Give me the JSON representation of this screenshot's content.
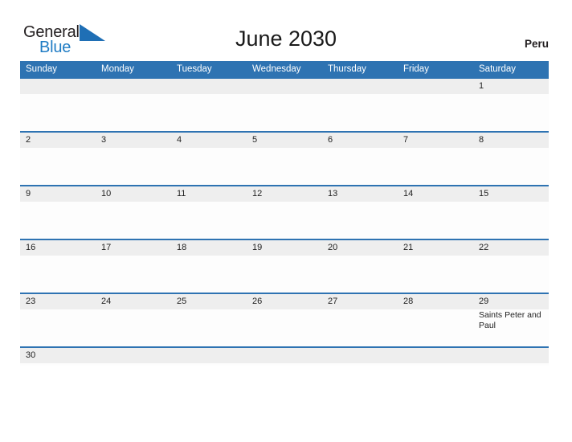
{
  "brand": {
    "name_part1": "General",
    "name_part2": "Blue",
    "flag_icon": "blue-triangle-flag-icon",
    "accent_color": "#1f7cc4"
  },
  "header": {
    "title": "June 2030",
    "country": "Peru"
  },
  "theme": {
    "header_blue": "#2e73b2",
    "band_gray": "#eeeeee",
    "text_dark": "#222222"
  },
  "calendar": {
    "month": "June",
    "year": "2030",
    "day_headers": [
      "Sunday",
      "Monday",
      "Tuesday",
      "Wednesday",
      "Thursday",
      "Friday",
      "Saturday"
    ],
    "weeks": [
      {
        "days": [
          {
            "num": "",
            "event": ""
          },
          {
            "num": "",
            "event": ""
          },
          {
            "num": "",
            "event": ""
          },
          {
            "num": "",
            "event": ""
          },
          {
            "num": "",
            "event": ""
          },
          {
            "num": "",
            "event": ""
          },
          {
            "num": "1",
            "event": ""
          }
        ]
      },
      {
        "days": [
          {
            "num": "2",
            "event": ""
          },
          {
            "num": "3",
            "event": ""
          },
          {
            "num": "4",
            "event": ""
          },
          {
            "num": "5",
            "event": ""
          },
          {
            "num": "6",
            "event": ""
          },
          {
            "num": "7",
            "event": ""
          },
          {
            "num": "8",
            "event": ""
          }
        ]
      },
      {
        "days": [
          {
            "num": "9",
            "event": ""
          },
          {
            "num": "10",
            "event": ""
          },
          {
            "num": "11",
            "event": ""
          },
          {
            "num": "12",
            "event": ""
          },
          {
            "num": "13",
            "event": ""
          },
          {
            "num": "14",
            "event": ""
          },
          {
            "num": "15",
            "event": ""
          }
        ]
      },
      {
        "days": [
          {
            "num": "16",
            "event": ""
          },
          {
            "num": "17",
            "event": ""
          },
          {
            "num": "18",
            "event": ""
          },
          {
            "num": "19",
            "event": ""
          },
          {
            "num": "20",
            "event": ""
          },
          {
            "num": "21",
            "event": ""
          },
          {
            "num": "22",
            "event": ""
          }
        ]
      },
      {
        "days": [
          {
            "num": "23",
            "event": ""
          },
          {
            "num": "24",
            "event": ""
          },
          {
            "num": "25",
            "event": ""
          },
          {
            "num": "26",
            "event": ""
          },
          {
            "num": "27",
            "event": ""
          },
          {
            "num": "28",
            "event": ""
          },
          {
            "num": "29",
            "event": "Saints Peter and Paul"
          }
        ]
      },
      {
        "days": [
          {
            "num": "30",
            "event": ""
          },
          {
            "num": "",
            "event": ""
          },
          {
            "num": "",
            "event": ""
          },
          {
            "num": "",
            "event": ""
          },
          {
            "num": "",
            "event": ""
          },
          {
            "num": "",
            "event": ""
          },
          {
            "num": "",
            "event": ""
          }
        ]
      }
    ]
  }
}
